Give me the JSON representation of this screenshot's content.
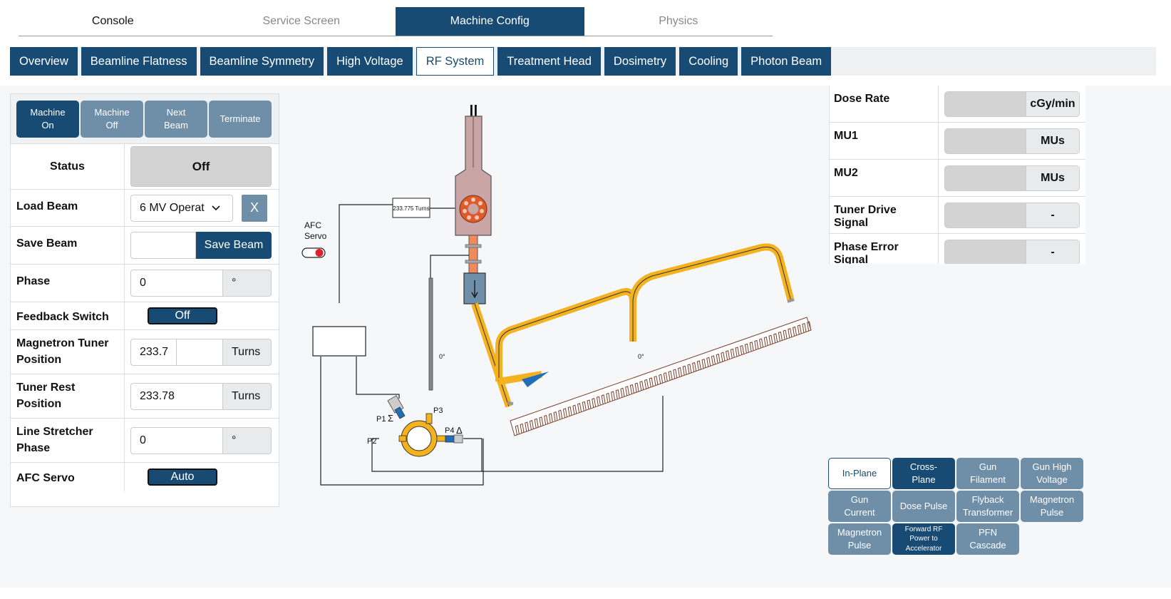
{
  "top_tabs": [
    "Console",
    "Service Screen",
    "Machine Config",
    "Physics"
  ],
  "sub_tabs": [
    "Overview",
    "Beamline Flatness",
    "Beamline Symmetry",
    "High Voltage",
    "RF System",
    "Treatment Head",
    "Dosimetry",
    "Cooling",
    "Photon Beam"
  ],
  "controls": {
    "machine_on": "Machine\nOn",
    "machine_off": "Machine\nOff",
    "next_beam": "Next\nBeam",
    "terminate": "Terminate"
  },
  "params": {
    "status": {
      "label": "Status",
      "value": "Off"
    },
    "load_beam": {
      "label": "Load Beam",
      "value": "6 MV Operat",
      "clear": "X"
    },
    "save_beam": {
      "label": "Save Beam",
      "button": "Save Beam"
    },
    "phase": {
      "label": "Phase",
      "value": "0",
      "unit": "°"
    },
    "feedback_switch": {
      "label": "Feedback Switch",
      "value": "Off"
    },
    "magnetron_tuner": {
      "label": "Magnetron Tuner Position",
      "value": "233.7",
      "unit": "Turns"
    },
    "tuner_rest": {
      "label": "Tuner Rest Position",
      "value": "233.78",
      "unit": "Turns"
    },
    "line_stretcher": {
      "label": "Line Stretcher Phase",
      "value": "0",
      "unit": "°"
    },
    "afc_servo": {
      "label": "AFC Servo",
      "value": "Auto"
    }
  },
  "diagram": {
    "afc_label_1": "AFC",
    "afc_label_2": "Servo",
    "turns_box": "233.775 Turns",
    "angle_1": "0°",
    "angle_2": "0°",
    "p1": "P1",
    "p2": "P2",
    "p3": "P3",
    "p4": "P4",
    "sigma": "Σ",
    "delta": "Δ"
  },
  "readouts": [
    {
      "label": "Dose Rate",
      "unit": "cGy/min"
    },
    {
      "label": "MU1",
      "unit": "MUs"
    },
    {
      "label": "MU2",
      "unit": "MUs"
    },
    {
      "label": "Tuner Drive Signal",
      "unit": "-"
    },
    {
      "label": "Phase Error Signal",
      "unit": "-"
    }
  ],
  "plot_buttons": [
    "In-Plane",
    "Cross-\nPlane",
    "Gun\nFilament",
    "Gun High\nVoltage",
    "Gun\nCurrent",
    "Dose Pulse",
    "Flyback\nTransformer",
    "Magnetron\nPulse",
    "Magnetron\nPulse",
    "Forward RF\nPower to\nAccelerator",
    "PFN\nCascade"
  ],
  "colors": {
    "primary": "#174b73",
    "secondary": "#6f8ea8",
    "waveguide": "#f5b21f",
    "magnetron": "#dd5a2a"
  }
}
